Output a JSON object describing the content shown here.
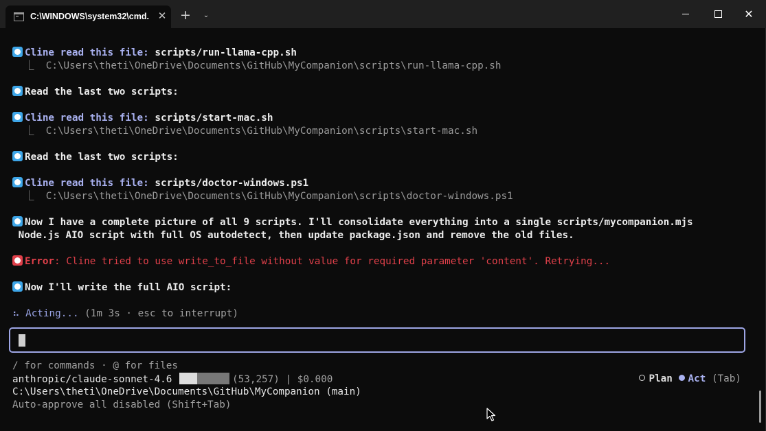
{
  "window": {
    "tab_title": "C:\\WINDOWS\\system32\\cmd.",
    "close_tab_glyph": "✕",
    "new_tab_glyph": "+",
    "dropdown_glyph": "⌄",
    "close_window_glyph": "✕"
  },
  "colors": {
    "bullet_blue": "#3ea6e8",
    "bullet_red": "#e0404a",
    "accent": "#a9b1f0",
    "background": "#0c0c0c"
  },
  "log": {
    "l1": {
      "label": "Cline read this file:",
      "value": " scripts/run-llama-cpp.sh"
    },
    "l2": {
      "prefix": "  ⎿  ",
      "path": "C:\\Users\\theti\\OneDrive\\Documents\\GitHub\\MyCompanion\\scripts\\run-llama-cpp.sh"
    },
    "l3": {
      "text": "Read the last two scripts:"
    },
    "l4": {
      "label": "Cline read this file:",
      "value": " scripts/start-mac.sh"
    },
    "l5": {
      "prefix": "  ⎿  ",
      "path": "C:\\Users\\theti\\OneDrive\\Documents\\GitHub\\MyCompanion\\scripts\\start-mac.sh"
    },
    "l6": {
      "text": "Read the last two scripts:"
    },
    "l7": {
      "label": "Cline read this file:",
      "value": " scripts/doctor-windows.ps1"
    },
    "l8": {
      "prefix": "  ⎿  ",
      "path": "C:\\Users\\theti\\OneDrive\\Documents\\GitHub\\MyCompanion\\scripts\\doctor-windows.ps1"
    },
    "l9": {
      "text": "Now I have a complete picture of all 9 scripts. I'll consolidate everything into a single scripts/mycompanion.mjs"
    },
    "l10": {
      "text": " Node.js AIO script with full OS autodetect, then update package.json and remove the old files."
    },
    "l11": {
      "label": "Error",
      "message": ": Cline tried to use write_to_file without value for required parameter 'content'. Retrying..."
    },
    "l12": {
      "text": "Now I'll write the full AIO script:"
    }
  },
  "status": {
    "spinner": "⠦ ",
    "acting_label": "Acting...",
    "acting_detail": " (1m 3s · esc to interrupt)"
  },
  "footer": {
    "hint": "/ for commands · @ for files",
    "plan_label": "Plan",
    "act_label": "Act",
    "tab_hint": " (Tab)",
    "model": "anthropic/claude-sonnet-4.6",
    "context_fill_fraction": 0.36,
    "tokens": "(53,257)",
    "separator": " | ",
    "cost": "$0.000",
    "cwd": "C:\\Users\\theti\\OneDrive\\Documents\\GitHub\\MyCompanion (main)",
    "auto_approve": "Auto-approve all disabled (Shift+Tab)"
  }
}
